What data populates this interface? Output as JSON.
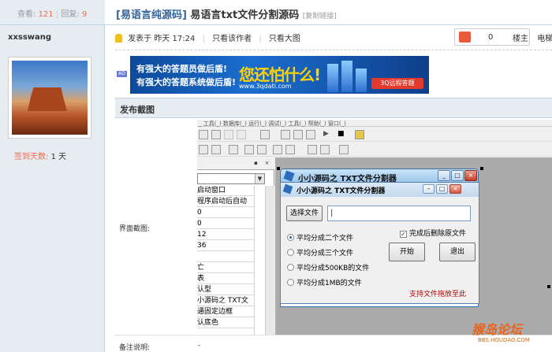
{
  "stats": {
    "view_label": "查看:",
    "view_count": "121",
    "reply_label": "回复:",
    "reply_count": "9"
  },
  "author": {
    "name": "xxsswang",
    "checkin_label": "签到天数:",
    "checkin_value": "1 天"
  },
  "thread": {
    "category": "[易语言纯源码]",
    "title": "易语言txt文件分割源码",
    "copy_link": "[复制链接]"
  },
  "post_meta": {
    "posted": "发表于 昨天 17:24",
    "only_author": "只看该作者",
    "only_image": "只看大图",
    "floor": "楼主",
    "tail": "电梯"
  },
  "like": {
    "count": "0"
  },
  "ad": {
    "tag": "AD",
    "line1": "有强大的答题员做后盾!",
    "line2": "有强大的答题系统做后盾!",
    "slogan": "您还怕什么!",
    "url": "www.3qdati.com",
    "button": "3Q远程答题"
  },
  "section": {
    "title": "发布截图",
    "shot_label": "界面截图:",
    "note_label": "备注说明:",
    "note_value": "-"
  },
  "ide": {
    "menu": "_ 工具(_) 数据库(_) 运行(_) 调试(_) 工具(_) 帮助(_) 窗口(_)",
    "props": [
      "启动窗口",
      "程序启动后自动",
      "0",
      "0",
      "12",
      "36",
      "",
      "亡",
      "表",
      "认型",
      "小源码之 TXT文",
      "通固定边框",
      "认底色"
    ]
  },
  "app": {
    "outer_title": "小小源码之 TXT文件分割器",
    "inner_title": "小小源码之 TXT文件分割器",
    "choose_button": "选择文件",
    "path_value": "|",
    "delete_after": "完成后删除原文件",
    "options": [
      "平均分成二个文件",
      "平均分成三个文件",
      "平均分成500KB的文件",
      "平均分成1MB的文件"
    ],
    "start_button": "开始",
    "exit_button": "退出",
    "hint": "支持文件拖放至此"
  },
  "watermark": {
    "text": "猴岛论坛",
    "url": "BBS.HOUDAO.COM"
  }
}
